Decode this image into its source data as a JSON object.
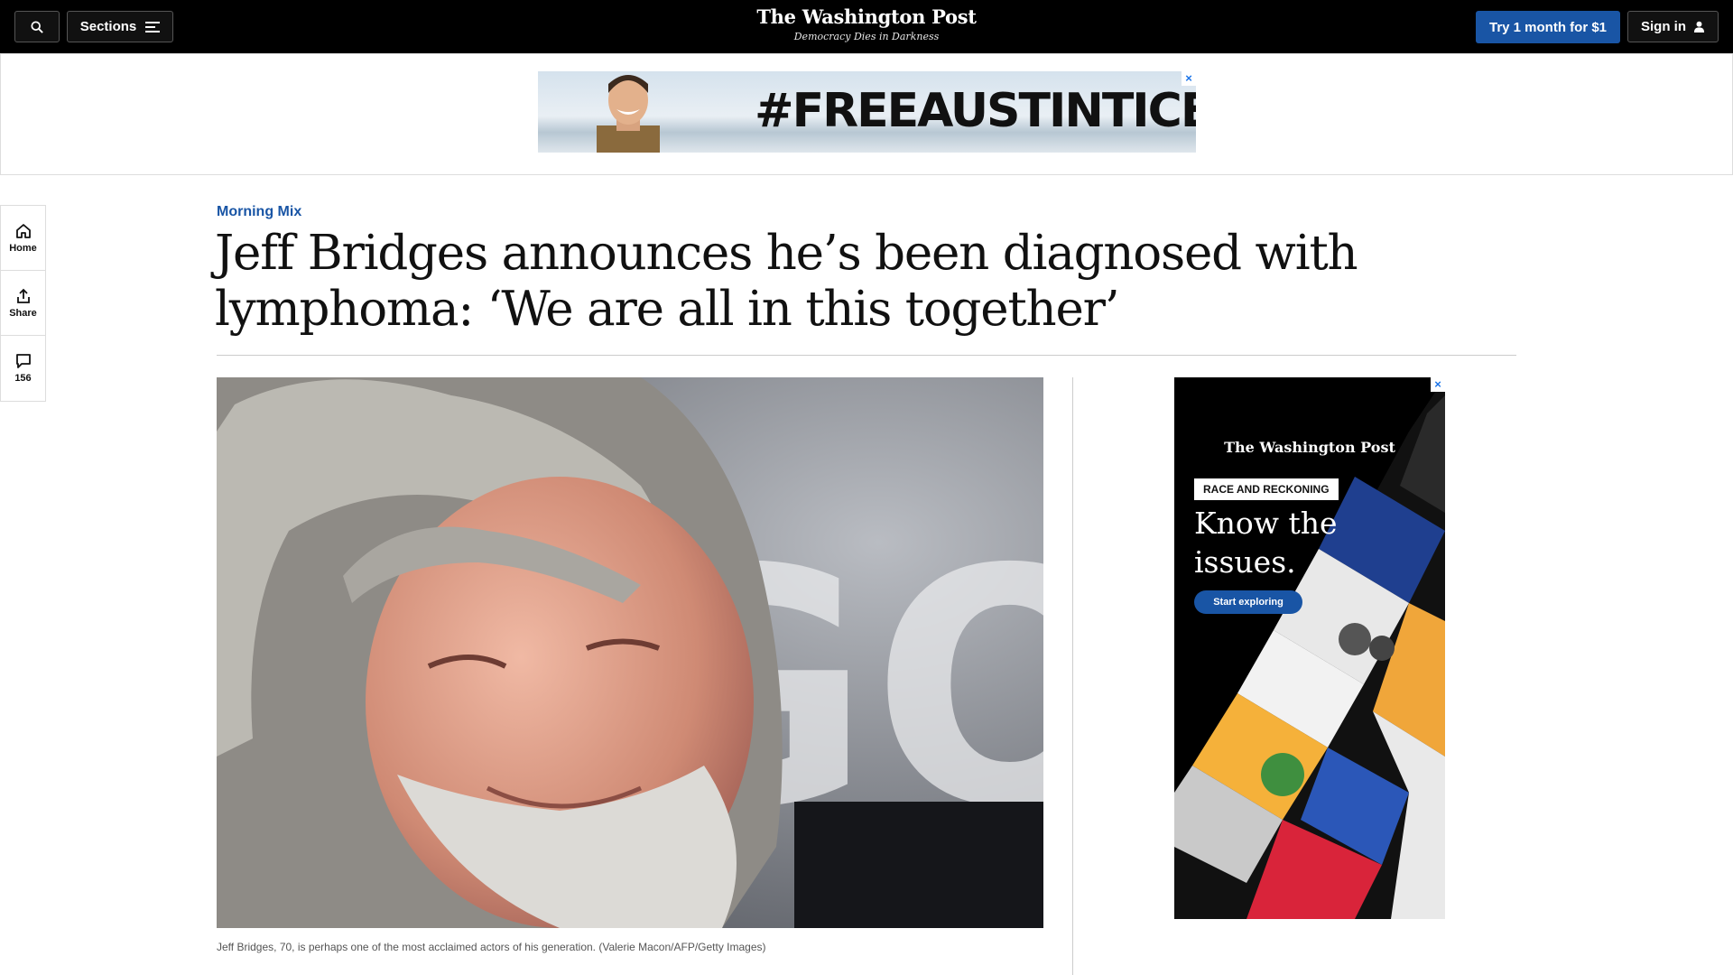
{
  "header": {
    "sections_label": "Sections",
    "logo": "The Washington Post",
    "tagline": "Democracy Dies in Darkness",
    "trial_label": "Try 1 month for $1",
    "signin_label": "Sign in"
  },
  "banner_ad": {
    "text": "#FREEAUSTINTICE",
    "close": "×"
  },
  "rail": {
    "home_label": "Home",
    "share_label": "Share",
    "comments_count": "156"
  },
  "article": {
    "kicker": "Morning Mix",
    "headline": "Jeff Bridges announces he’s been diagnosed with lymphoma: ‘We are all in this together’",
    "caption": "Jeff Bridges, 70, is perhaps one of the most acclaimed actors of his generation. (Valerie Macon/AFP/Getty Images)",
    "photo_backdrop_text": "GOLD"
  },
  "side_ad": {
    "logo": "The Washington Post",
    "badge": "RACE AND RECKONING",
    "headline": "Know the issues.",
    "cta": "Start exploring",
    "close": "×"
  },
  "colors": {
    "brand_blue": "#1955a5",
    "topbar": "#000000"
  }
}
